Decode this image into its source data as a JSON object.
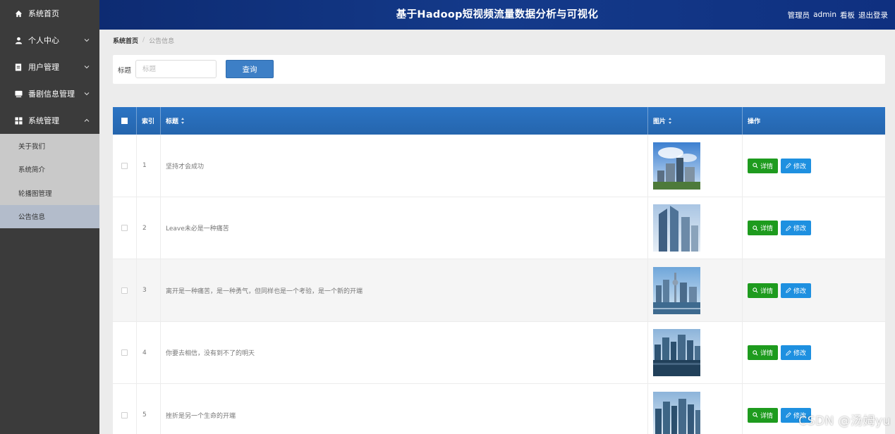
{
  "header": {
    "title": "基于Hadoop短视频流量数据分析与可视化",
    "role": "管理员",
    "username": "admin",
    "dashboard_link": "看板",
    "logout_link": "退出登录"
  },
  "sidebar": {
    "items": [
      {
        "label": "系统首页",
        "icon": "home-icon"
      },
      {
        "label": "个人中心",
        "icon": "user-icon"
      },
      {
        "label": "用户管理",
        "icon": "document-icon"
      },
      {
        "label": "番剧信息管理",
        "icon": "tv-icon"
      },
      {
        "label": "系统管理",
        "icon": "grid-icon"
      }
    ],
    "submenu": [
      {
        "label": "关于我们"
      },
      {
        "label": "系统简介"
      },
      {
        "label": "轮播图管理"
      },
      {
        "label": "公告信息"
      }
    ]
  },
  "breadcrumb": {
    "home": "系统首页",
    "current": "公告信息"
  },
  "search": {
    "label": "标题",
    "placeholder": "标题",
    "value": "",
    "button": "查询"
  },
  "table": {
    "columns": {
      "index": "索引",
      "title": "标题",
      "image": "图片",
      "ops": "操作"
    },
    "rows": [
      {
        "index": "1",
        "title": "坚持才会成功",
        "detail": "详情",
        "edit": "修改"
      },
      {
        "index": "2",
        "title": "Leave未必是一种痛苦",
        "detail": "详情",
        "edit": "修改"
      },
      {
        "index": "3",
        "title": "离开是一种痛苦，是一种勇气，但同样也是一个考验，是一个新的开端",
        "detail": "详情",
        "edit": "修改"
      },
      {
        "index": "4",
        "title": "你要去相信，没有到不了的明天",
        "detail": "详情",
        "edit": "修改"
      },
      {
        "index": "5",
        "title": "挫折是另一个生命的开端",
        "detail": "详情",
        "edit": "修改"
      }
    ]
  },
  "watermark": "CSDN @汤姆yu",
  "colors": {
    "header_bg": "#0d2b72",
    "sidebar_bg": "#3b3b3b",
    "table_head": "#2b74c4",
    "detail_button": "#1e9b1e",
    "edit_button": "#1e90e0"
  }
}
